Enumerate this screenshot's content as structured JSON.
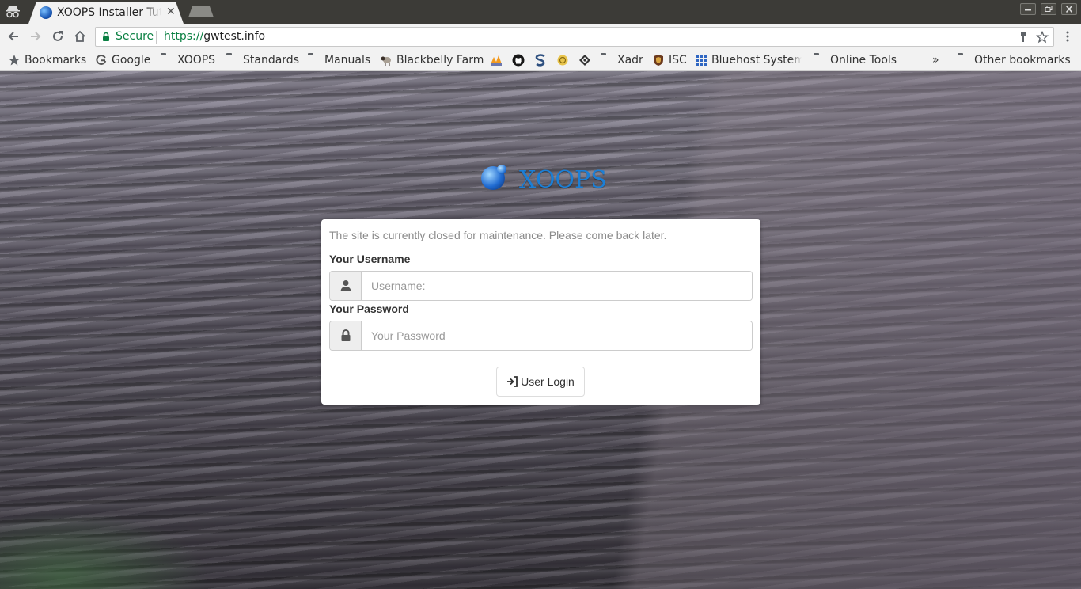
{
  "browser": {
    "tab": {
      "title": "XOOPS Installer Tutorial",
      "close_glyph": "✕"
    },
    "address_bar": {
      "secure_label": "Secure",
      "url_scheme": "https://",
      "url_host": "gwtest.info"
    },
    "bookmarks": [
      {
        "label": "Bookmarks",
        "icon": "star-icon"
      },
      {
        "label": "Google",
        "icon": "google-icon"
      },
      {
        "label": "XOOPS",
        "icon": "folder-icon"
      },
      {
        "label": "Standards",
        "icon": "folder-icon"
      },
      {
        "label": "Manuals",
        "icon": "folder-icon"
      },
      {
        "label": "Blackbelly Farm",
        "icon": "sheep-icon"
      },
      {
        "label": "",
        "icon": "phpmyadmin-icon"
      },
      {
        "label": "",
        "icon": "github-icon"
      },
      {
        "label": "",
        "icon": "stack-icon"
      },
      {
        "label": "",
        "icon": "emblem-icon"
      },
      {
        "label": "",
        "icon": "diamond-grid-icon"
      },
      {
        "label": "Xadr",
        "icon": "folder-icon"
      },
      {
        "label": "ISC",
        "icon": "shield-icon"
      },
      {
        "label": "Bluehost System",
        "icon": "grid-icon"
      },
      {
        "label": "Online Tools",
        "icon": "folder-icon"
      }
    ],
    "bookmarks_overflow": "»",
    "other_bookmarks": "Other bookmarks"
  },
  "page": {
    "logo_text": "XOOPS",
    "notice": "The site is currently closed for maintenance. Please come back later.",
    "username_label": "Your Username",
    "username_placeholder": "Username:",
    "password_label": "Your Password",
    "password_placeholder": "Your Password",
    "login_button": "User Login"
  },
  "colors": {
    "secure_green": "#0b8043",
    "xoops_blue": "#1b7fd6",
    "chrome_frame": "#3c3b37"
  }
}
